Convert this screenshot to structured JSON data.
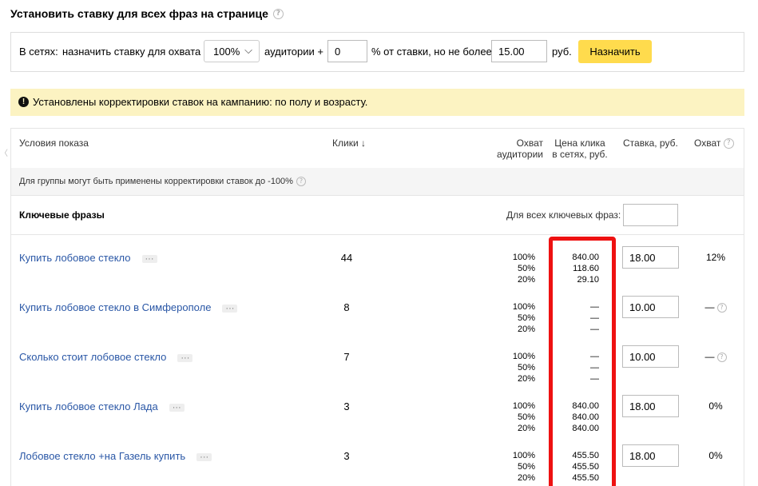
{
  "header": {
    "title": "Установить ставку для всех фраз на странице",
    "help_icon": "question-circle-icon"
  },
  "bid_panel": {
    "networks_label": "В сетях:",
    "assign_label": "назначить ставку для охвата",
    "coverage_select": "100%",
    "audience_label": "аудитории +",
    "percent_value": "0",
    "percent_label": "% от ставки, но не более",
    "max_value": "15.00",
    "currency_label": "руб.",
    "assign_button": "Назначить"
  },
  "notice": {
    "icon": "exclamation-circle-icon",
    "text": "Установлены корректировки ставок на кампанию: по полу и возрасту."
  },
  "table": {
    "headers": {
      "conditions": "Условия показа",
      "clicks": "Клики ↓",
      "coverage_line1": "Охват",
      "coverage_line2": "аудитории",
      "price_line1": "Цена клика",
      "price_line2": "в сетях, руб.",
      "bid": "Ставка, руб.",
      "reach": "Охват"
    },
    "group_notice": "Для группы могут быть применены корректировки ставок до -100%",
    "section_title": "Ключевые фразы",
    "all_phrases_label": "Для всех ключевых фраз:",
    "all_phrases_value": "",
    "rows": [
      {
        "phrase": "Купить лобовое стекло",
        "clicks": "44",
        "coverage": [
          "100%",
          "50%",
          "20%"
        ],
        "prices": [
          "840.00",
          "118.60",
          "29.10"
        ],
        "bid": "18.00",
        "reach": "12%"
      },
      {
        "phrase": "Купить лобовое стекло в Симферополе",
        "clicks": "8",
        "coverage": [
          "100%",
          "50%",
          "20%"
        ],
        "prices": [
          "—",
          "—",
          "—"
        ],
        "bid": "10.00",
        "reach": "—"
      },
      {
        "phrase": "Сколько стоит лобовое стекло",
        "clicks": "7",
        "coverage": [
          "100%",
          "50%",
          "20%"
        ],
        "prices": [
          "—",
          "—",
          "—"
        ],
        "bid": "10.00",
        "reach": "—"
      },
      {
        "phrase": "Купить лобовое стекло Лада",
        "clicks": "3",
        "coverage": [
          "100%",
          "50%",
          "20%"
        ],
        "prices": [
          "840.00",
          "840.00",
          "840.00"
        ],
        "bid": "18.00",
        "reach": "0%"
      },
      {
        "phrase": "Лобовое стекло +на Газель купить",
        "clicks": "3",
        "coverage": [
          "100%",
          "50%",
          "20%"
        ],
        "prices": [
          "455.50",
          "455.50",
          "455.50"
        ],
        "bid": "18.00",
        "reach": "0%"
      }
    ]
  },
  "colors": {
    "accent_button": "#ffdb4d",
    "notice_bg": "#fcf3c2",
    "link": "#2a57a6",
    "highlight": "#ee1111"
  }
}
